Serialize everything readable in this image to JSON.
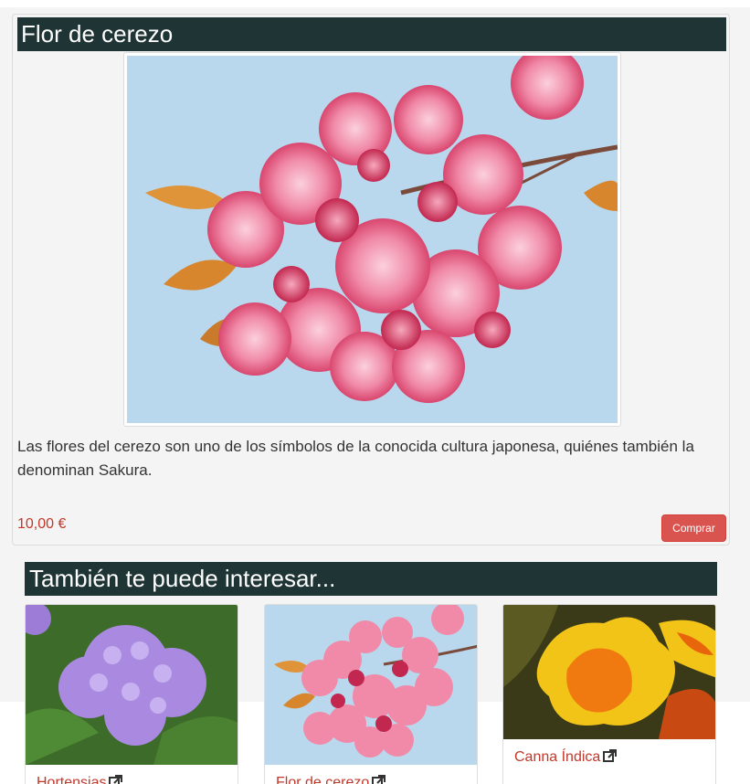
{
  "product": {
    "title": "Flor de cerezo",
    "image_alt": "Flor de cerezo",
    "description": "Las flores del cerezo son uno de los símbolos de la conocida cultura japonesa, quiénes también la denominan Sakura.",
    "price": "10,00 €",
    "buy_label": "Comprar"
  },
  "related": {
    "heading": "También te puede interesar...",
    "items": [
      {
        "name": "Hortensias",
        "icon": "external-link-icon"
      },
      {
        "name": "Flor de cerezo",
        "icon": "external-link-icon"
      },
      {
        "name": "Canna Índica",
        "icon": "external-link-icon"
      }
    ]
  },
  "colors": {
    "header_bg": "#1f3434",
    "accent_red": "#c0392b",
    "button_red": "#d9534f",
    "page_bg": "#f4f4f4"
  }
}
